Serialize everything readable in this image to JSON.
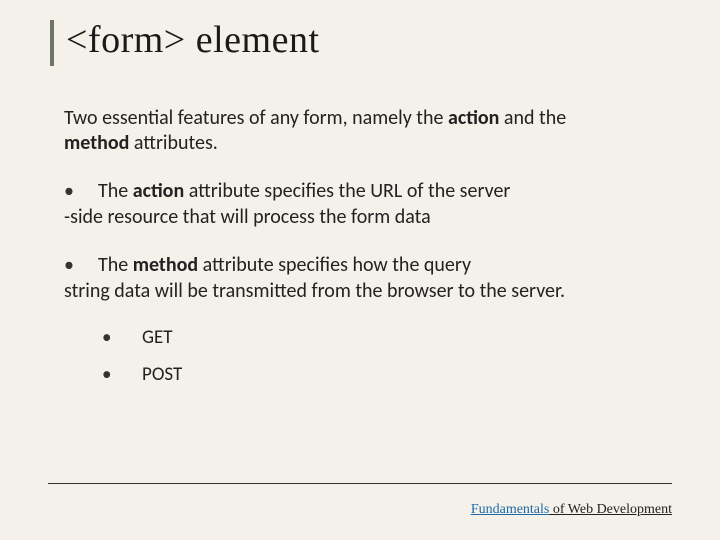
{
  "title": "<form> element",
  "intro": {
    "pre": "Two essential features of any form, namely the ",
    "b1": "action",
    "mid": " and the ",
    "b2": "method",
    "post": " attributes."
  },
  "bullets": [
    {
      "line1_pre": "The ",
      "line1_b": "action",
      "line1_post": " attribute specifies the URL of the server",
      "rest": "-side resource that will process the form data"
    },
    {
      "line1_pre": "The ",
      "line1_b": "method",
      "line1_post": " attribute specifies how the query",
      "rest": "string data will be transmitted from the browser to the server."
    }
  ],
  "sub_items": [
    "GET",
    "POST"
  ],
  "footer": {
    "brand": "Fundamentals",
    "rest": " of Web Development"
  },
  "glyphs": {
    "bullet": "•"
  }
}
